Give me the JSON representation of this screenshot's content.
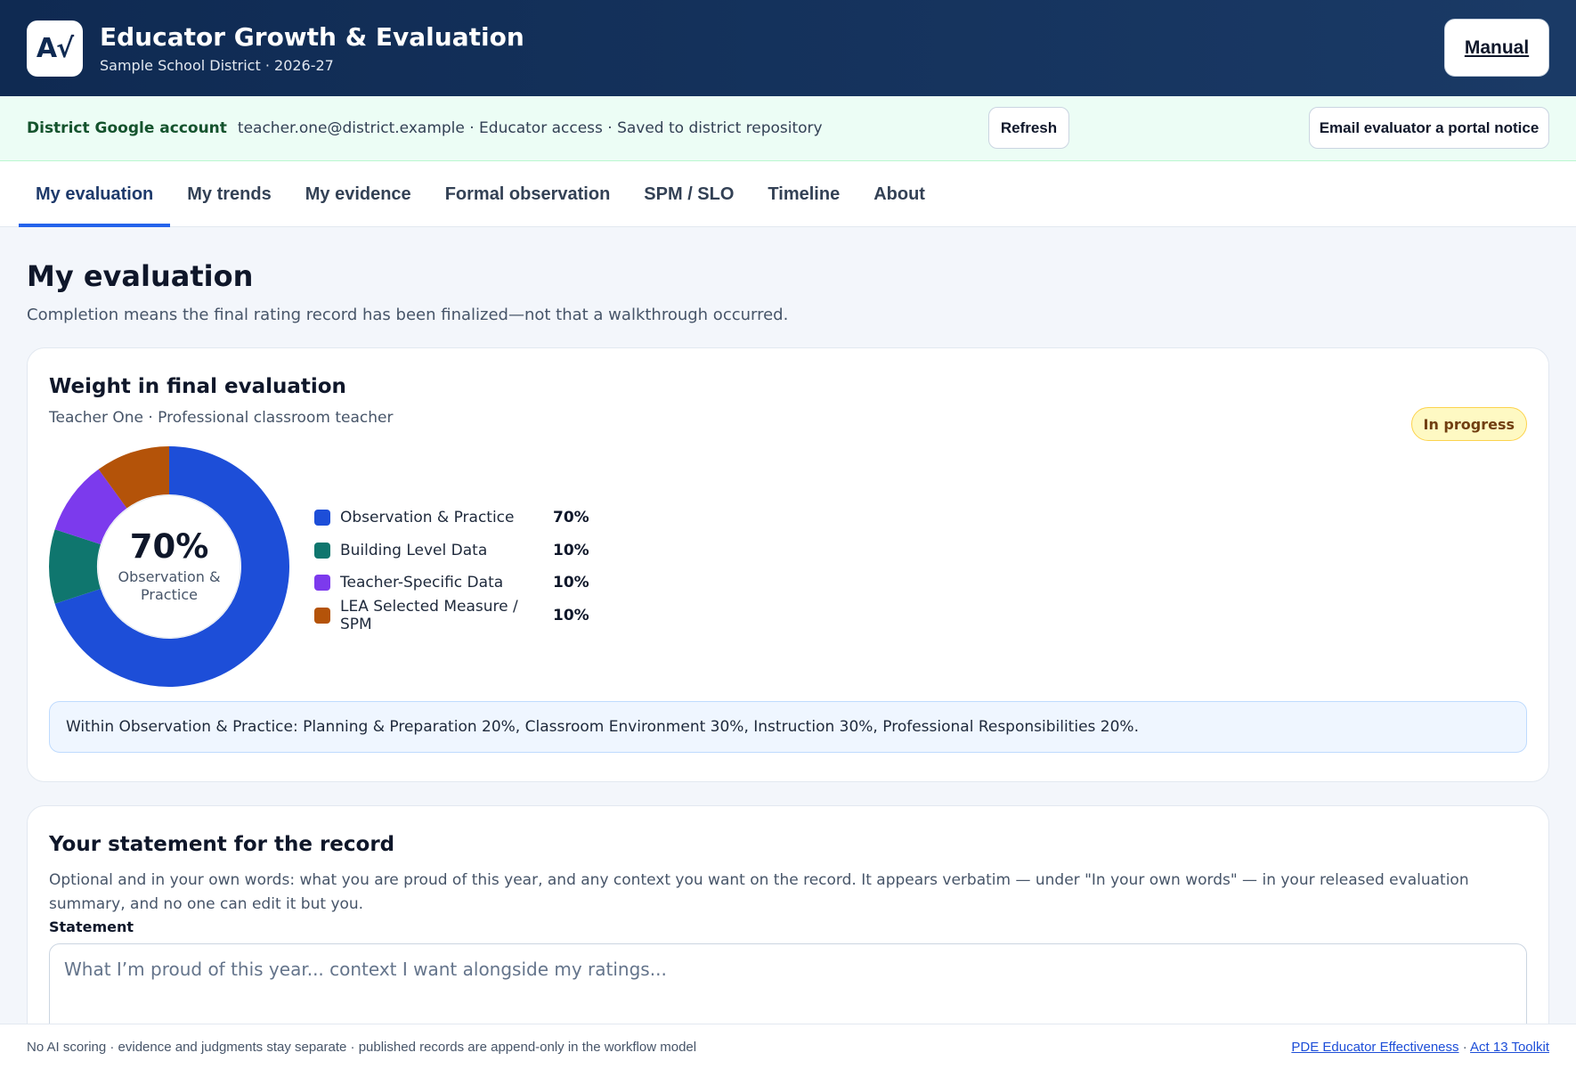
{
  "header": {
    "logo_text": "A√",
    "title": "Educator Growth & Evaluation",
    "subtitle": "Sample School District · 2026-27",
    "manual_label": "Manual"
  },
  "account": {
    "label": "District Google account",
    "info": "teacher.one@district.example · Educator access · Saved to district repository",
    "refresh_label": "Refresh",
    "email_label": "Email evaluator a portal notice"
  },
  "tabs": [
    {
      "label": "My evaluation",
      "active": true
    },
    {
      "label": "My trends",
      "active": false
    },
    {
      "label": "My evidence",
      "active": false
    },
    {
      "label": "Formal observation",
      "active": false
    },
    {
      "label": "SPM / SLO",
      "active": false
    },
    {
      "label": "Timeline",
      "active": false
    },
    {
      "label": "About",
      "active": false
    }
  ],
  "main": {
    "title": "My evaluation",
    "subtitle": "Completion means the final rating record has been finalized—not that a walkthrough occurred."
  },
  "weight_card": {
    "title": "Weight in final evaluation",
    "subtitle": "Teacher One · Professional classroom teacher",
    "status_badge": "In progress",
    "center_value": "70%",
    "center_label": "Observation & Practice",
    "note": "Within Observation & Practice: Planning & Preparation 20%, Classroom Environment 30%, Instruction 30%, Professional Responsibilities 20%."
  },
  "chart_data": {
    "type": "pie",
    "categories": [
      "Observation & Practice",
      "Building Level Data",
      "Teacher-Specific Data",
      "LEA Selected Measure / SPM"
    ],
    "values": [
      70,
      10,
      10,
      10
    ],
    "value_labels": [
      "70%",
      "10%",
      "10%",
      "10%"
    ],
    "colors": [
      "#1d4ed8",
      "#0f766e",
      "#7c3aed",
      "#b45309"
    ],
    "donut": true
  },
  "statement_card": {
    "title": "Your statement for the record",
    "description": "Optional and in your own words: what you are proud of this year, and any context you want on the record. It appears verbatim — under \"In your own words\" — in your released evaluation summary, and no one can edit it but you.",
    "field_label": "Statement",
    "placeholder": "What I’m proud of this year... context I want alongside my ratings..."
  },
  "footer": {
    "text": "No AI scoring · evidence and judgments stay separate · published records are append-only in the workflow model",
    "link1": "PDE Educator Effectiveness",
    "separator": "·",
    "link2": "Act 13 Toolkit"
  }
}
